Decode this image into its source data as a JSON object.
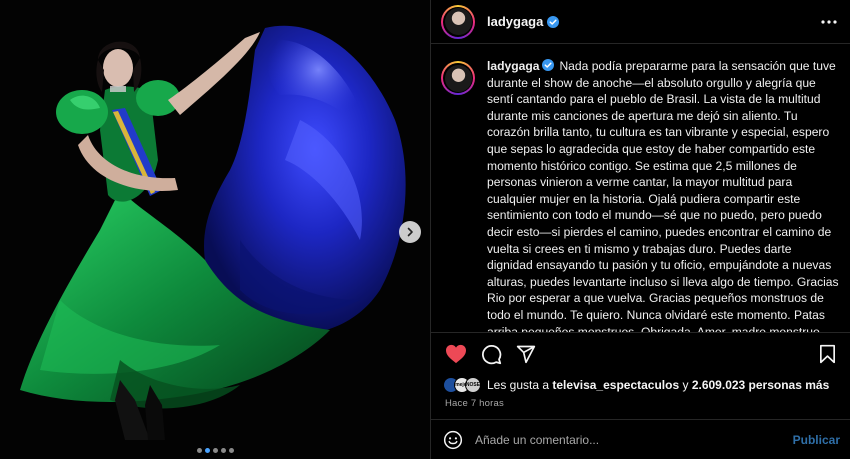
{
  "post": {
    "username": "ladygaga",
    "caption": "Nada podía prepararme para la sensación que tuve durante el show de anoche—el absoluto orgullo y alegría que sentí cantando para el pueblo de Brasil. La vista de la multitud durante mis canciones de apertura me dejó sin aliento. Tu corazón brilla tanto, tu cultura es tan vibrante y especial, espero que sepas lo agradecida que estoy de haber compartido este momento histórico contigo. Se estima que 2,5 millones de personas vinieron a verme cantar, la mayor multitud para cualquier mujer en la historia. Ojalá pudiera compartir este sentimiento con todo el mundo—sé que no puedo, pero puedo decir esto—si pierdes el camino, puedes encontrar el camino de vuelta si crees en ti mismo y trabajas duro. Puedes darte dignidad ensayando tu pasión y tu oficio, empujándote a nuevas alturas, puedes levantarte incluso si lleva algo de tiempo. Gracias Rio por esperar a que vuelva. Gracias pequeños monstruos de todo el mundo. Te quiero. Nunca olvidaré este momento. Patas arriba pequeños monstruos. Obrigada. Amor, madre monstruo.",
    "likes_prefix": "Les gusta a",
    "likes_user": "televisa_espectaculos",
    "likes_connector": "y",
    "likes_others": "2.609.023 personas más",
    "timestamp": "Hace 7 horas",
    "carousel": {
      "total": 5,
      "active": 1
    },
    "like_state": "liked"
  },
  "comment": {
    "placeholder": "Añade un comentario...",
    "publish_label": "Publicar"
  },
  "mini_avatar_labels": [
    "",
    "mejor",
    "NOSE"
  ],
  "icons": {
    "verified": "verified-badge-icon",
    "more": "more-options-icon",
    "like": "heart-icon",
    "comment": "comment-icon",
    "share": "share-icon",
    "save": "bookmark-icon",
    "emoji": "emoji-icon",
    "next": "chevron-right-icon"
  },
  "colors": {
    "like_red": "#ed4956",
    "verified_blue": "#3897f0",
    "publish_blue": "#2f6fa8",
    "dress_green": "#0f8a3c",
    "cape_blue": "#1f2bd6"
  }
}
